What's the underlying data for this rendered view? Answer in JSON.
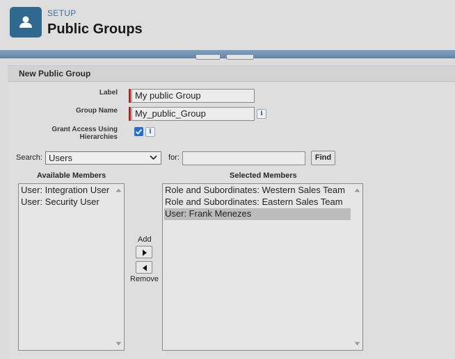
{
  "header": {
    "setup_label": "SETUP",
    "title": "Public Groups",
    "icon": "user-icon",
    "accent": "#2f6a8e"
  },
  "section": {
    "title": "New Public Group"
  },
  "form": {
    "label_caption": "Label",
    "label_value": "My public Group",
    "group_name_caption": "Group Name",
    "group_name_value": "My_public_Group",
    "grant_access_line1": "Grant Access Using",
    "grant_access_line2": "Hierarchies",
    "grant_access_checked": true,
    "info_glyph": "i"
  },
  "search": {
    "search_caption": "Search:",
    "search_selected": "Users",
    "for_caption": "for:",
    "for_value": "",
    "find_label": "Find"
  },
  "available": {
    "heading": "Available Members",
    "items": [
      "User: Integration User",
      "User: Security User"
    ]
  },
  "selected": {
    "heading": "Selected Members",
    "items": [
      "Role and Subordinates: Western Sales Team",
      "Role and Subordinates: Eastern Sales Team",
      "User: Frank Menezes"
    ],
    "highlighted_index": 2
  },
  "transfer": {
    "add_label": "Add",
    "remove_label": "Remove"
  }
}
